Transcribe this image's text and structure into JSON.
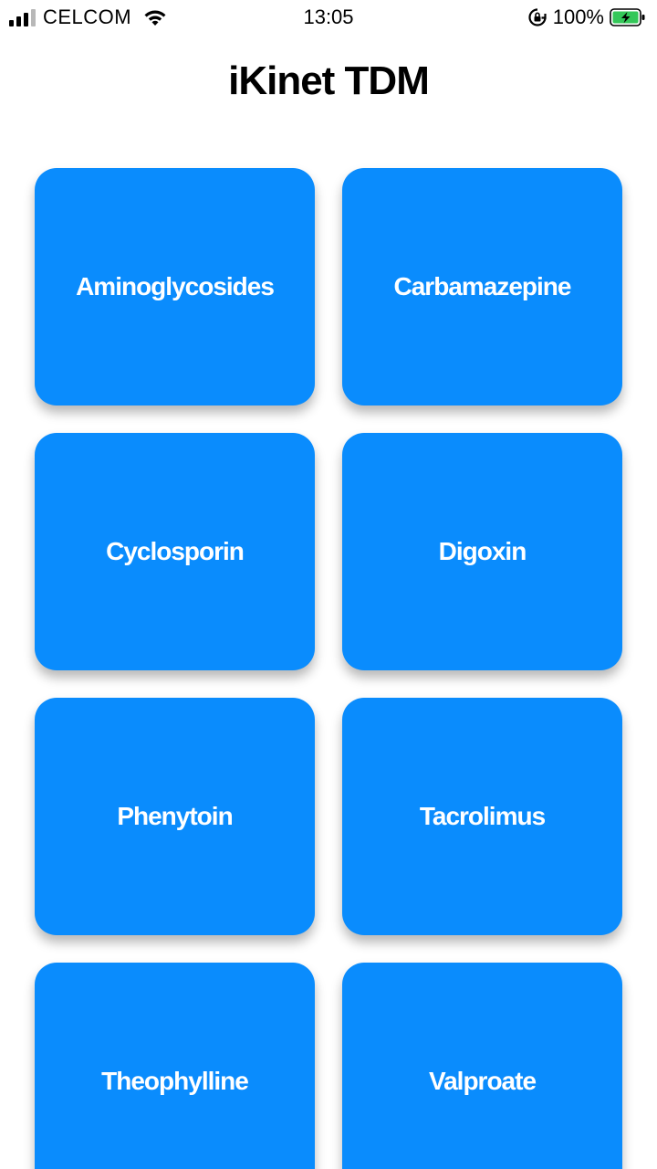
{
  "status_bar": {
    "carrier": "CELCOM",
    "time": "13:05",
    "battery_percent": "100%",
    "signal_bars_active": 3,
    "signal_bars_total": 4,
    "battery_color": "#34c759",
    "icons": [
      "signal-icon",
      "wifi-icon",
      "orientation-lock-icon",
      "battery-charging-icon"
    ]
  },
  "header": {
    "title": "iKinet TDM"
  },
  "drugs": {
    "accent_color": "#0a8cfd",
    "items": [
      {
        "label": "Aminoglycosides"
      },
      {
        "label": "Carbamazepine"
      },
      {
        "label": "Cyclosporin"
      },
      {
        "label": "Digoxin"
      },
      {
        "label": "Phenytoin"
      },
      {
        "label": "Tacrolimus"
      },
      {
        "label": "Theophylline"
      },
      {
        "label": "Valproate"
      }
    ]
  }
}
